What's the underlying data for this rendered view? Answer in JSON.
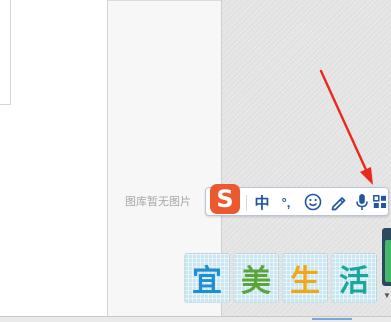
{
  "gallery": {
    "empty_text": "图库暂无图片"
  },
  "ime": {
    "logo": "S",
    "mode_label": "中",
    "punct_label": "°,",
    "icons": [
      "emoji-icon",
      "handwrite-icon",
      "microphone-icon",
      "toolbox-icon"
    ]
  },
  "logo": {
    "chars": [
      "宜",
      "美",
      "生",
      "活"
    ],
    "colors": [
      "#1f8fd1",
      "#5aa53a",
      "#f0a71a",
      "#17a79c"
    ]
  },
  "annotation": {
    "arrow_color": "#e8291c"
  },
  "colors": {
    "ime_accent": "#2255a5",
    "ime_logo_bg": "#ea5a2e"
  }
}
